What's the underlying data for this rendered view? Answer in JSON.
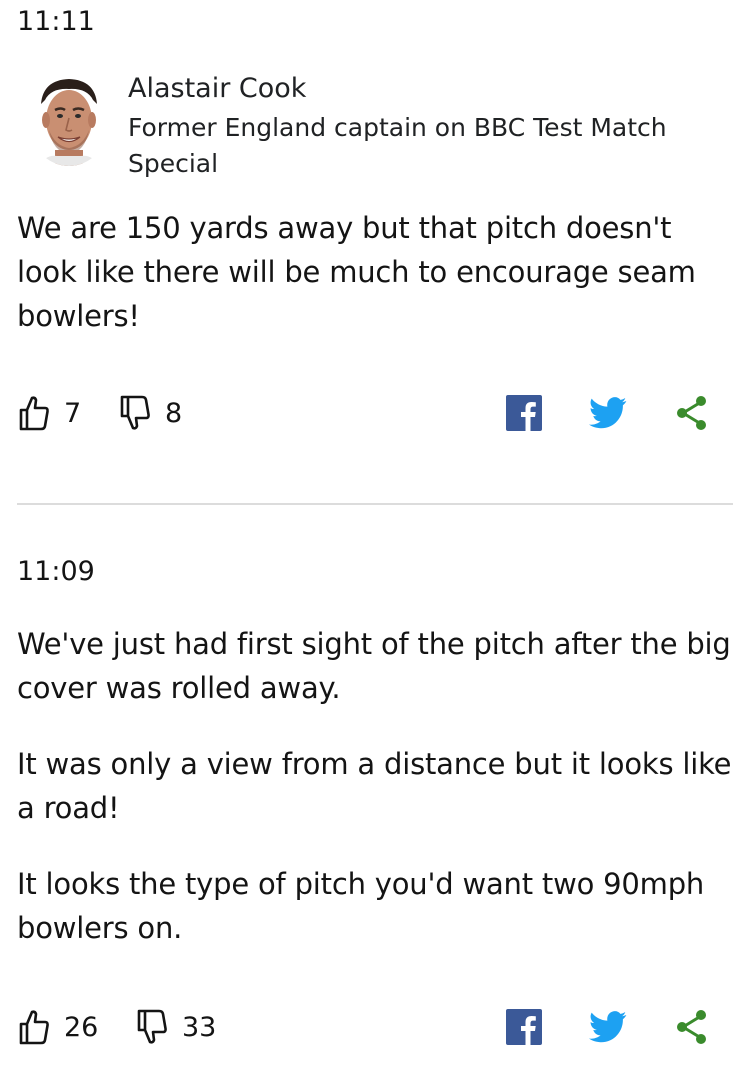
{
  "posts": [
    {
      "time": "11:11",
      "contributor": {
        "name": "Alastair Cook",
        "role": "Former England captain on BBC Test Match Special"
      },
      "paragraphs": [
        "We are 150 yards away but that pitch doesn't look like there will be much to encourage seam bowlers!"
      ],
      "likes": "7",
      "dislikes": "8"
    },
    {
      "time": "11:09",
      "paragraphs": [
        "We've just had first sight of the pitch after the big cover was rolled away.",
        "It was only a view from a distance but it looks like a road!",
        "It looks the type of pitch you'd want two 90mph bowlers on."
      ],
      "likes": "26",
      "dislikes": "33"
    }
  ],
  "icons": {
    "like": "thumbs-up-icon",
    "dislike": "thumbs-down-icon",
    "facebook": "facebook-icon",
    "twitter": "twitter-icon",
    "share": "share-icon"
  },
  "colors": {
    "facebook": "#3b5998",
    "twitter": "#1da1f2",
    "share": "#3a8b2c",
    "divider": "#dcdcdc"
  }
}
